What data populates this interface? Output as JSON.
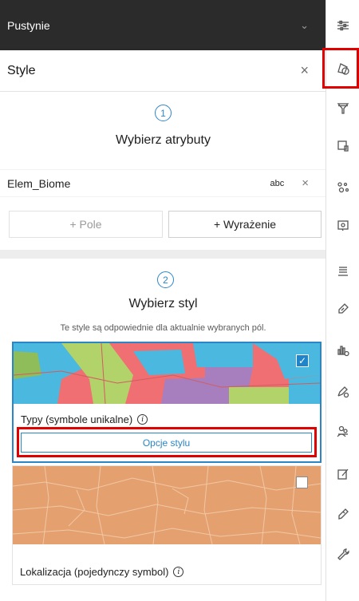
{
  "layer": {
    "name": "Pustynie"
  },
  "style_panel": {
    "title": "Style"
  },
  "step1": {
    "number": "1",
    "title": "Wybierz atrybuty"
  },
  "attribute": {
    "name": "Elem_Biome",
    "type": "abc"
  },
  "buttons": {
    "add_field": "+ Pole",
    "add_expression": "+ Wyrażenie"
  },
  "step2": {
    "number": "2",
    "title": "Wybierz styl",
    "hint": "Te style są odpowiednie dla aktualnie wybranych pól."
  },
  "styles": [
    {
      "label": "Typy (symbole unikalne)",
      "selected": true,
      "options_label": "Opcje stylu"
    },
    {
      "label": "Lokalizacja (pojedynczy symbol)",
      "selected": false
    }
  ],
  "colors": {
    "accent": "#2a86c6",
    "header_bg": "#2b2b2b",
    "highlight": "#e00000",
    "single_symbol_fill": "#e4a16f"
  },
  "toolbar": [
    {
      "icon": "layer-properties-icon"
    },
    {
      "icon": "styles-icon"
    },
    {
      "icon": "filter-icon"
    },
    {
      "icon": "effects-icon"
    },
    {
      "icon": "clustering-icon"
    },
    {
      "icon": "popups-icon"
    },
    {
      "icon": "fields-icon"
    },
    {
      "icon": "labels-icon"
    },
    {
      "icon": "charts-icon"
    },
    {
      "icon": "edit-settings-icon"
    },
    {
      "icon": "sharing-icon"
    },
    {
      "icon": "sketch-icon"
    },
    {
      "icon": "measure-icon"
    },
    {
      "icon": "tools-icon"
    }
  ]
}
